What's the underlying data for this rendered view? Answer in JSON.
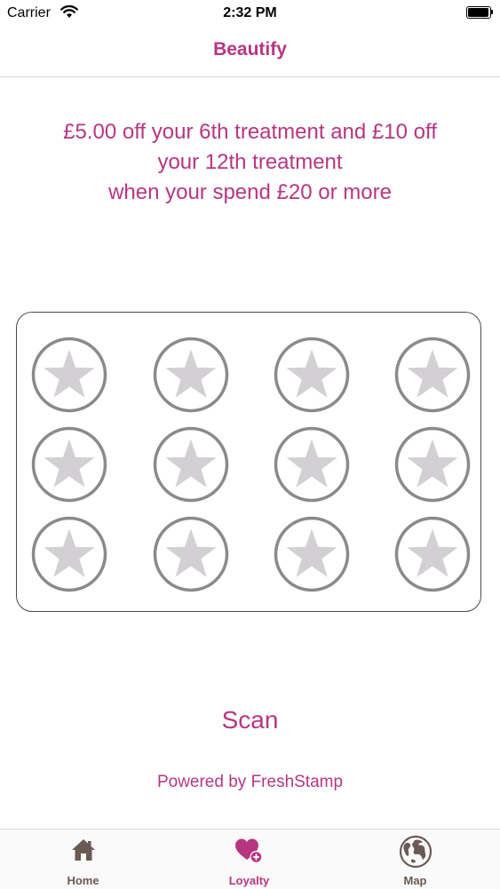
{
  "status_bar": {
    "carrier": "Carrier",
    "time": "2:32 PM"
  },
  "nav": {
    "title": "Beautify"
  },
  "offer": {
    "line1": "£5.00 off your 6th treatment and £10 off",
    "line2": "your 12th treatment",
    "line3": "when your spend £20 or more"
  },
  "stamp_card": {
    "total_stamps": 12,
    "collected_stamps": 0,
    "stamp_icon": "star-icon"
  },
  "scan": {
    "label": "Scan"
  },
  "footer": {
    "powered_by": "Powered by FreshStamp"
  },
  "tabs": [
    {
      "label": "Home",
      "icon": "house-icon"
    },
    {
      "label": "Loyalty",
      "icon": "heart-plus-icon"
    },
    {
      "label": "Map",
      "icon": "globe-icon"
    }
  ],
  "colors": {
    "brand": "#b83582",
    "stamp_ring": "#8a8a8a",
    "stamp_star": "#d2d0d3",
    "tab_text": "#6b5a53"
  }
}
